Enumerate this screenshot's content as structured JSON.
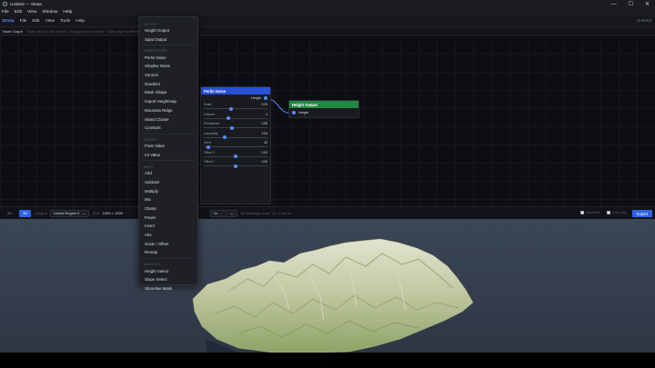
{
  "window": {
    "title": "Untitled — Strata",
    "controls": [
      "—",
      "☐",
      "✕"
    ]
  },
  "menubar": {
    "items": [
      "File",
      "Edit",
      "View",
      "Window",
      "Help"
    ]
  },
  "toolbar": {
    "brand": "Strata",
    "items": [
      "File",
      "Edit",
      "View",
      "Tools",
      "Help"
    ],
    "doc_name": "Untitled"
  },
  "graph": {
    "title": "Node Graph",
    "hint": "Right-click to add nodes · Drag ports to connect · Click edge to delete"
  },
  "nodes": {
    "perlin": {
      "title": "Perlin Noise",
      "output_label": "Height",
      "params": [
        {
          "label": "Scale",
          "value": "0.25",
          "level": 0.42
        },
        {
          "label": "Octaves",
          "value": "4",
          "level": 0.38
        },
        {
          "label": "Persistence",
          "value": "0.50",
          "level": 0.44
        },
        {
          "label": "Lacunarity",
          "value": "2.00",
          "level": 0.32
        },
        {
          "label": "Seed",
          "value": "42",
          "level": 0.04
        },
        {
          "label": "Offset X",
          "value": "0.00",
          "level": 0.5
        },
        {
          "label": "Offset Y",
          "value": "0.00",
          "level": 0.5
        }
      ]
    },
    "height_output": {
      "title": "Height Output",
      "input_label": "Height"
    }
  },
  "context_menu": {
    "sections": [
      {
        "title": "OUTPUT",
        "items": [
          "Height Output",
          "Splat Output"
        ]
      },
      {
        "title": "GENERATORS",
        "items": [
          "Perlin Noise",
          "Simplex Noise",
          "Voronoi",
          "Gradient",
          "Mask Shape",
          "Import Heightmap",
          "Mountain Ridge",
          "Island Cluster",
          "Constant"
        ]
      },
      {
        "title": "VALUES",
        "items": [
          "Float Value",
          "Int Value"
        ]
      },
      {
        "title": "MATH",
        "items": [
          "Add",
          "Subtract",
          "Multiply",
          "Mix",
          "Clamp",
          "Power",
          "Invert",
          "Abs",
          "Scale / Offset",
          "Remap"
        ]
      },
      {
        "title": "ANALYSIS",
        "items": [
          "Height Select",
          "Slope Select",
          "Shoreline Mask"
        ]
      }
    ]
  },
  "viewport_toolbar": {
    "view_2d": "2D",
    "view_3d": "3D",
    "engine_label": "Engine",
    "engine_value": "Unreal Engine 5",
    "size_label": "Size",
    "size_value": "1009 × 1009",
    "zoom_value": "1x",
    "info": "UE landscape scale: 1.0 · 1 per vtx",
    "toggle_1": "Wireframe",
    "toggle_2": "Color map",
    "export_label": "Export"
  },
  "colors": {
    "accent": "#2f63e6",
    "perlin_header": "#2a4fd6",
    "output_header": "#1f8a3f",
    "terrain_low": "#8fa86a",
    "terrain_high": "#d8dcc4"
  }
}
